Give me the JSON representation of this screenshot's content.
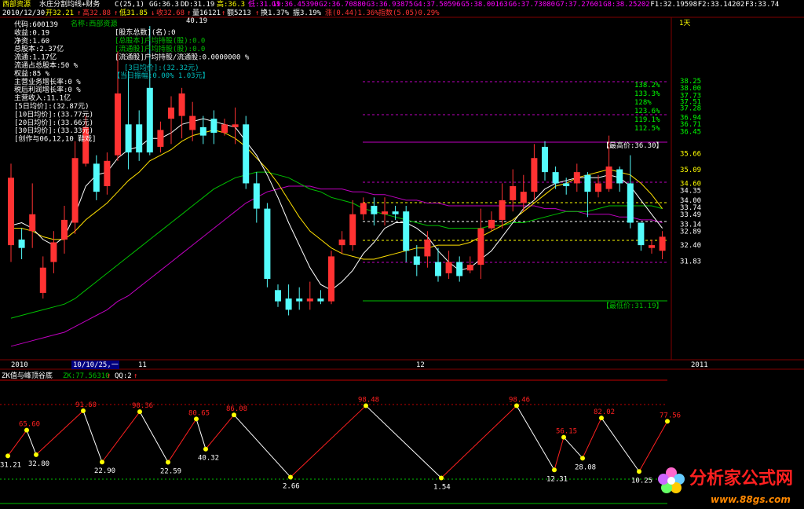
{
  "header": {
    "stock_name": "西部资源",
    "formula": "水庄分割均线+财务",
    "indicator_c": "C(25,1)",
    "gg": "GG:36.3",
    "dd": "DD:31.19",
    "gao": "高:36.3",
    "di": "低:31.19",
    "g_levels": [
      "G1:36.45390",
      "G2:36.70880",
      "G3:36.93875",
      "G4:37.50596",
      "G5:38.00163",
      "G6:37.73080",
      "G7:37.27601",
      "G8:38.25202",
      "F1:32.19598",
      "F2:33.14202",
      "F3:33.74"
    ],
    "date": "2010/12/30",
    "open": "开32.21",
    "open_arrow": "↑",
    "high": "高32.88",
    "high_arrow": "↑",
    "low": "低31.85",
    "low_arrow": "↓",
    "close": "收32.68",
    "close_arrow": "↑",
    "volume": "量16121",
    "volume_arrow": "↑",
    "amount": "额5213",
    "amount_arrow": "↑",
    "turnover": "换1.37%",
    "amplitude": "振3.19%",
    "change": "涨(0.44)1.36%",
    "index": "指数(5.05)0.29%"
  },
  "info_panel": {
    "lines": [
      "代码:600139",
      "收益:0.19",
      "净资:1.60",
      "总股本:2.37亿",
      "流通:1.17亿",
      "流通占总股本:50 %",
      "权益:85 %",
      "主营业务增长率:0 %",
      "税后利润增长率:0 %",
      "主营收入:11.1亿",
      "[5日均价]:(32.87元)",
      "[10日均价]:(33.77元)",
      "[20日均价]:(33.66元)",
      "[30日均价]:(33.33元)",
      "[创作与06,12,10 鞋戏]"
    ],
    "name_label": "名称:西部资源",
    "holders": [
      "[股东总数](名):0",
      "[总股本]户均持股(股):0.0",
      "[流通股]户均持股(股):0.0",
      "[流通股]户均持股/流通股:0.0000000 %"
    ],
    "avg3": "[3日均价]:(32.32元)",
    "cur_change": "【当日振幅:0.00% 1.03元】",
    "top_label": "40.19",
    "period": "1天"
  },
  "price_labels": {
    "max_label": "【最高价:36.30】",
    "min_label": "【最低价:31.19】",
    "right_scale": [
      "38.25",
      "38.00",
      "37.73",
      "37.51",
      "37.28",
      "36.94",
      "36.71",
      "36.45",
      "35.66",
      "35.09",
      "34.60",
      "34.35",
      "34.00",
      "33.74",
      "33.49",
      "33.14",
      "32.89",
      "32.40",
      "31.83"
    ],
    "fib_labels": [
      "138.2%",
      "133.3%",
      "128%",
      "123.6%",
      "119.1%",
      "112.5%"
    ]
  },
  "time_axis": {
    "labels": [
      "2010",
      "10/10/25,一",
      "11",
      "12",
      "2011"
    ]
  },
  "panel2": {
    "title": "ZK值与峰顶谷底",
    "zk": "ZK:77.56310",
    "zk_arrow": "↑",
    "qq": "QQ:2",
    "qq_arrow": "↑"
  },
  "colors": {
    "up": "#ff3232",
    "down": "#54fcfc",
    "yellow": "#ffff00",
    "blue": "#0000ff",
    "ma_white": "#ffffff",
    "ma_yellow": "#ffe000",
    "ma_green": "#00c000",
    "ma_magenta": "#c000c0",
    "grid_red": "#800000"
  },
  "logo": {
    "text": "分析家公式网",
    "url": "www.88gs.com"
  },
  "chart_data": {
    "type": "candlestick",
    "ylim": [
      28.6,
      40.4
    ],
    "candles": [
      {
        "o": 32.4,
        "c": 34.8,
        "h": 35.3,
        "l": 31.8
      },
      {
        "o": 32.6,
        "c": 32.3,
        "h": 33.0,
        "l": 31.9
      },
      {
        "o": 32.9,
        "c": 33.5,
        "h": 34.6,
        "l": 32.3
      },
      {
        "o": 30.7,
        "c": 31.6,
        "h": 32.0,
        "l": 30.5
      },
      {
        "o": 31.8,
        "c": 32.5,
        "h": 32.9,
        "l": 31.4
      },
      {
        "o": 32.6,
        "c": 33.3,
        "h": 33.8,
        "l": 32.1
      },
      {
        "o": 33.2,
        "c": 35.5,
        "h": 36.1,
        "l": 32.8
      },
      {
        "o": 35.3,
        "c": 36.6,
        "h": 37.0,
        "l": 35.2
      },
      {
        "o": 35.3,
        "c": 34.3,
        "h": 35.6,
        "l": 34.0
      },
      {
        "o": 34.5,
        "c": 35.4,
        "h": 35.7,
        "l": 34.2
      },
      {
        "o": 35.6,
        "c": 37.8,
        "h": 39.3,
        "l": 35.4
      },
      {
        "o": 36.7,
        "c": 35.7,
        "h": 38.6,
        "l": 35.1
      },
      {
        "o": 36.7,
        "c": 35.7,
        "h": 37.2,
        "l": 35.4
      },
      {
        "o": 38.0,
        "c": 35.7,
        "h": 40.2,
        "l": 35.6
      },
      {
        "o": 35.9,
        "c": 36.5,
        "h": 36.8,
        "l": 35.7
      },
      {
        "o": 36.9,
        "c": 37.3,
        "h": 37.7,
        "l": 36.0
      },
      {
        "o": 37.0,
        "c": 37.8,
        "h": 38.0,
        "l": 36.2
      },
      {
        "o": 36.5,
        "c": 37.0,
        "h": 37.5,
        "l": 36.1
      },
      {
        "o": 36.6,
        "c": 36.3,
        "h": 37.0,
        "l": 36.0
      },
      {
        "o": 36.9,
        "c": 36.4,
        "h": 37.2,
        "l": 36.0
      },
      {
        "o": 36.4,
        "c": 36.7,
        "h": 36.9,
        "l": 36.3
      },
      {
        "o": 36.6,
        "c": 36.7,
        "h": 37.3,
        "l": 36.0
      },
      {
        "o": 36.7,
        "c": 34.6,
        "h": 37.0,
        "l": 34.4
      },
      {
        "o": 34.6,
        "c": 33.7,
        "h": 35.0,
        "l": 33.2
      },
      {
        "o": 33.7,
        "c": 31.2,
        "h": 33.9,
        "l": 30.9
      },
      {
        "o": 30.8,
        "c": 30.4,
        "h": 31.0,
        "l": 30.2
      },
      {
        "o": 30.5,
        "c": 30.1,
        "h": 31.0,
        "l": 29.9
      },
      {
        "o": 30.5,
        "c": 30.4,
        "h": 30.9,
        "l": 30.1
      },
      {
        "o": 30.4,
        "c": 30.5,
        "h": 31.1,
        "l": 30.1
      },
      {
        "o": 30.5,
        "c": 30.4,
        "h": 30.8,
        "l": 30.3
      },
      {
        "o": 30.4,
        "c": 32.0,
        "h": 32.2,
        "l": 30.3
      },
      {
        "o": 32.4,
        "c": 32.6,
        "h": 32.9,
        "l": 32.1
      },
      {
        "o": 32.4,
        "c": 33.5,
        "h": 34.0,
        "l": 32.2
      },
      {
        "o": 33.5,
        "c": 33.9,
        "h": 34.1,
        "l": 33.3
      },
      {
        "o": 33.8,
        "c": 33.5,
        "h": 34.1,
        "l": 33.1
      },
      {
        "o": 33.5,
        "c": 33.6,
        "h": 34.1,
        "l": 33.1
      },
      {
        "o": 33.6,
        "c": 33.5,
        "h": 33.8,
        "l": 33.3
      },
      {
        "o": 33.6,
        "c": 32.2,
        "h": 33.8,
        "l": 31.8
      },
      {
        "o": 32.0,
        "c": 31.7,
        "h": 32.4,
        "l": 31.3
      },
      {
        "o": 32.0,
        "c": 32.6,
        "h": 32.9,
        "l": 31.6
      },
      {
        "o": 31.8,
        "c": 31.3,
        "h": 32.3,
        "l": 31.1
      },
      {
        "o": 31.4,
        "c": 31.8,
        "h": 32.2,
        "l": 31.2
      },
      {
        "o": 31.8,
        "c": 31.3,
        "h": 32.0,
        "l": 31.1
      },
      {
        "o": 31.5,
        "c": 31.7,
        "h": 32.0,
        "l": 31.4
      },
      {
        "o": 31.7,
        "c": 33.0,
        "h": 33.7,
        "l": 31.2
      },
      {
        "o": 33.0,
        "c": 33.3,
        "h": 33.6,
        "l": 32.9
      },
      {
        "o": 33.3,
        "c": 34.0,
        "h": 34.6,
        "l": 33.0
      },
      {
        "o": 34.0,
        "c": 34.5,
        "h": 35.1,
        "l": 33.6
      },
      {
        "o": 33.9,
        "c": 34.3,
        "h": 34.9,
        "l": 33.6
      },
      {
        "o": 34.3,
        "c": 35.5,
        "h": 36.0,
        "l": 34.0
      },
      {
        "o": 35.9,
        "c": 35.0,
        "h": 36.1,
        "l": 34.7
      },
      {
        "o": 35.0,
        "c": 34.6,
        "h": 35.2,
        "l": 34.4
      },
      {
        "o": 34.6,
        "c": 34.5,
        "h": 34.8,
        "l": 34.2
      },
      {
        "o": 34.6,
        "c": 35.0,
        "h": 35.3,
        "l": 34.3
      },
      {
        "o": 34.9,
        "c": 34.3,
        "h": 35.0,
        "l": 33.4
      },
      {
        "o": 34.3,
        "c": 34.6,
        "h": 34.9,
        "l": 34.1
      },
      {
        "o": 34.4,
        "c": 35.2,
        "h": 36.3,
        "l": 34.3
      },
      {
        "o": 35.1,
        "c": 34.6,
        "h": 35.2,
        "l": 34.3
      },
      {
        "o": 34.6,
        "c": 33.2,
        "h": 35.6,
        "l": 33.0
      },
      {
        "o": 33.2,
        "c": 32.4,
        "h": 33.2,
        "l": 32.2
      },
      {
        "o": 32.3,
        "c": 32.4,
        "h": 32.6,
        "l": 32.1
      },
      {
        "o": 32.2,
        "c": 32.7,
        "h": 32.9,
        "l": 31.9
      }
    ],
    "ma_white": [
      33.1,
      33.2,
      33.0,
      32.6,
      32.4,
      32.7,
      33.5,
      34.5,
      34.9,
      35.0,
      35.5,
      35.8,
      35.9,
      36.2,
      36.2,
      36.4,
      36.7,
      36.8,
      36.9,
      36.8,
      36.7,
      36.6,
      36.1,
      35.6,
      34.9,
      34.1,
      33.2,
      32.4,
      31.6,
      31.0,
      30.8,
      31.1,
      31.5,
      32.1,
      32.5,
      33.0,
      33.2,
      33.2,
      33.0,
      32.7,
      32.2,
      31.8,
      31.5,
      31.6,
      31.9,
      32.2,
      32.7,
      33.2,
      33.7,
      34.0,
      34.4,
      34.6,
      34.7,
      34.8,
      34.8,
      34.8,
      34.9,
      34.8,
      34.5,
      34.0,
      33.5,
      33.0
    ],
    "ma_yellow": [
      33.0,
      33.0,
      32.9,
      32.7,
      32.6,
      32.6,
      32.9,
      33.3,
      33.6,
      33.9,
      34.3,
      34.7,
      35.0,
      35.4,
      35.6,
      35.8,
      36.1,
      36.3,
      36.4,
      36.5,
      36.4,
      36.2,
      35.9,
      35.5,
      35.1,
      34.6,
      34.0,
      33.4,
      32.9,
      32.6,
      32.3,
      32.1,
      32.0,
      31.9,
      31.9,
      32.0,
      32.1,
      32.2,
      32.3,
      32.3,
      32.4,
      32.4,
      32.4,
      32.5,
      32.7,
      32.9,
      33.1,
      33.3,
      33.6,
      33.9,
      34.2,
      34.5,
      34.6,
      34.8,
      34.9,
      35.0,
      35.1,
      35.0,
      34.9,
      34.6,
      34.2,
      33.7
    ],
    "ma_green": [
      29.8,
      29.9,
      30.0,
      30.1,
      30.2,
      30.3,
      30.5,
      30.8,
      31.1,
      31.4,
      31.7,
      32.0,
      32.3,
      32.6,
      32.9,
      33.2,
      33.5,
      33.8,
      34.1,
      34.4,
      34.6,
      34.8,
      34.9,
      35.0,
      35.0,
      34.9,
      34.8,
      34.6,
      34.4,
      34.3,
      34.1,
      34.0,
      33.9,
      33.7,
      33.6,
      33.5,
      33.4,
      33.3,
      33.2,
      33.1,
      33.1,
      33.0,
      33.0,
      33.0,
      33.0,
      33.1,
      33.1,
      33.2,
      33.2,
      33.3,
      33.4,
      33.5,
      33.6,
      33.6,
      33.6,
      33.7,
      33.8,
      33.8,
      33.8,
      33.8,
      33.8,
      33.7
    ],
    "ma_magenta": [
      28.8,
      28.9,
      29.0,
      29.1,
      29.2,
      29.3,
      29.5,
      29.7,
      29.9,
      30.1,
      30.4,
      30.6,
      30.9,
      31.2,
      31.5,
      31.8,
      32.1,
      32.4,
      32.7,
      33.0,
      33.3,
      33.6,
      33.9,
      34.1,
      34.3,
      34.4,
      34.5,
      34.5,
      34.5,
      34.4,
      34.4,
      34.4,
      34.3,
      34.3,
      34.2,
      34.2,
      34.1,
      34.0,
      34.0,
      33.9,
      33.9,
      33.8,
      33.8,
      33.8,
      33.8,
      33.8,
      33.8,
      33.8,
      33.8,
      33.8,
      33.7,
      33.7,
      33.6,
      33.6,
      33.5,
      33.5,
      33.5,
      33.4,
      33.4,
      33.3,
      33.3,
      33.2
    ],
    "zk_points": [
      {
        "i": 0,
        "v": 31.21,
        "type": "valley"
      },
      {
        "i": 2,
        "v": 65.6,
        "type": "peak"
      },
      {
        "i": 3,
        "v": 32.8,
        "type": "valley"
      },
      {
        "i": 8,
        "v": 91.6,
        "type": "peak"
      },
      {
        "i": 10,
        "v": 22.9,
        "type": "valley"
      },
      {
        "i": 14,
        "v": 90.36,
        "type": "peak"
      },
      {
        "i": 17,
        "v": 22.59,
        "type": "valley"
      },
      {
        "i": 20,
        "v": 80.65,
        "type": "peak"
      },
      {
        "i": 21,
        "v": 40.32,
        "type": "valley"
      },
      {
        "i": 24,
        "v": 86.08,
        "type": "peak"
      },
      {
        "i": 30,
        "v": 2.66,
        "type": "valley"
      },
      {
        "i": 38,
        "v": 98.48,
        "type": "peak"
      },
      {
        "i": 46,
        "v": 1.54,
        "type": "valley"
      },
      {
        "i": 54,
        "v": 98.46,
        "type": "peak"
      },
      {
        "i": 58,
        "v": 12.31,
        "type": "valley"
      },
      {
        "i": 59,
        "v": 56.15,
        "type": "peak"
      },
      {
        "i": 61,
        "v": 28.08,
        "type": "valley"
      },
      {
        "i": 63,
        "v": 82.02,
        "type": "peak"
      },
      {
        "i": 67,
        "v": 10.25,
        "type": "valley"
      },
      {
        "i": 70,
        "v": 77.56,
        "type": "peak"
      }
    ],
    "zk_label_texts": [
      "31.21",
      "65.60",
      "32.80",
      "91.60",
      "22.90",
      "90.36",
      "22.59",
      "80.65",
      "40.32",
      "86.08",
      "2.66",
      "98.48",
      "1.54",
      "98.46",
      "12.31",
      "56.15",
      "28.08",
      "82.02",
      "10.25",
      "77.56"
    ]
  }
}
